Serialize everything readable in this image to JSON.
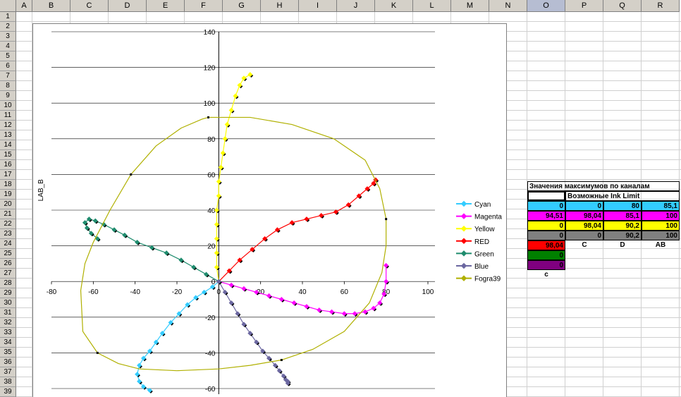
{
  "sheet": {
    "columns": [
      "A",
      "B",
      "C",
      "D",
      "E",
      "F",
      "G",
      "H",
      "I",
      "J",
      "K",
      "L",
      "M",
      "N",
      "O",
      "P",
      "Q",
      "R"
    ],
    "selected_column": "O",
    "rows": [
      "1",
      "2",
      "3",
      "4",
      "5",
      "6",
      "7",
      "8",
      "9",
      "10",
      "11",
      "12",
      "13",
      "14",
      "15",
      "16",
      "17",
      "18",
      "19",
      "20",
      "21",
      "22",
      "23",
      "24",
      "25",
      "26",
      "27",
      "28",
      "29",
      "30",
      "31",
      "32",
      "33",
      "34",
      "35",
      "36",
      "37",
      "38",
      "39"
    ]
  },
  "table": {
    "title": "Значения максимумов по каналам",
    "subtitle": "Возможные Ink Limit",
    "rows": [
      {
        "o": "0",
        "p": "0",
        "q": "80",
        "r": "85,1",
        "color": "#33ccff"
      },
      {
        "o": "94,51",
        "p": "98,04",
        "q": "85,1",
        "r": "100",
        "color": "#ff00ff"
      },
      {
        "o": "0",
        "p": "98,04",
        "q": "90,2",
        "r": "100",
        "color": "#ffff00"
      },
      {
        "o": "0",
        "p": "0",
        "q": "90,2",
        "r": "100",
        "color": "#808080"
      }
    ],
    "extra_o": [
      {
        "value": "98,04",
        "color": "#ff0000"
      },
      {
        "value": "0",
        "color": "#008000"
      },
      {
        "value": "0",
        "color": "#800080"
      }
    ],
    "labels": {
      "c_upper": "C",
      "d": "D",
      "ab": "AB",
      "c_lower": "c"
    }
  },
  "chart_data": {
    "type": "scatter",
    "ylabel": "LAB_B",
    "xlabel": "",
    "xlim": [
      -80,
      100
    ],
    "ylim": [
      -60,
      140
    ],
    "xticks": [
      "-80",
      "-60",
      "-40",
      "-20",
      "0",
      "20",
      "40",
      "60",
      "80",
      "100"
    ],
    "yticks": [
      "140",
      "120",
      "100",
      "80",
      "60",
      "40",
      "20",
      "0",
      "-20",
      "-40",
      "-60"
    ],
    "grid": true,
    "legend_position": "right",
    "series": [
      {
        "name": "Cyan",
        "color": "#33ccff",
        "x": [
          0,
          -3,
          -7,
          -11,
          -15,
          -19,
          -23,
          -27,
          -30,
          -33,
          -36,
          -38,
          -39,
          -38,
          -36,
          -33
        ],
        "y": [
          0,
          -3,
          -6,
          -9,
          -13,
          -18,
          -23,
          -29,
          -34,
          -39,
          -43,
          -47,
          -52,
          -56,
          -59,
          -61
        ]
      },
      {
        "name": "Magenta",
        "color": "#ff00ff",
        "x": [
          0,
          6,
          12,
          18,
          24,
          30,
          36,
          42,
          48,
          54,
          60,
          65,
          70,
          74,
          77,
          79,
          80,
          80
        ],
        "y": [
          0,
          -2,
          -4,
          -6,
          -8,
          -10,
          -12,
          -14,
          -16,
          -17,
          -18,
          -18,
          -17,
          -15,
          -12,
          -7,
          0,
          9
        ],
        "hull_x": [],
        "hull_y": []
      },
      {
        "name": "Yellow",
        "color": "#ffff00",
        "x": [
          0,
          -1,
          -1,
          -1,
          -1,
          -1,
          0,
          0,
          1,
          2,
          3,
          4,
          6,
          8,
          10,
          12,
          15
        ],
        "y": [
          0,
          8,
          16,
          24,
          32,
          40,
          48,
          56,
          64,
          72,
          80,
          88,
          96,
          104,
          110,
          114,
          116
        ]
      },
      {
        "name": "RED",
        "color": "#ff0000",
        "x": [
          0,
          5,
          10,
          16,
          22,
          28,
          35,
          42,
          49,
          56,
          62,
          67,
          71,
          74,
          75
        ],
        "y": [
          0,
          6,
          12,
          18,
          24,
          29,
          33,
          35,
          37,
          39,
          43,
          48,
          52,
          55,
          57
        ]
      },
      {
        "name": "Green",
        "color": "#1f8c6e",
        "x": [
          0,
          -6,
          -12,
          -18,
          -25,
          -32,
          -39,
          -45,
          -50,
          -55,
          -59,
          -62,
          -64,
          -63,
          -61,
          -58
        ],
        "y": [
          0,
          4,
          8,
          12,
          16,
          19,
          22,
          26,
          29,
          32,
          34,
          35,
          33,
          30,
          27,
          24
        ]
      },
      {
        "name": "Blue",
        "color": "#6b67a0",
        "x": [
          0,
          3,
          6,
          9,
          12,
          15,
          18,
          21,
          24,
          27,
          29,
          31,
          32,
          33,
          33
        ],
        "y": [
          0,
          -6,
          -12,
          -18,
          -24,
          -29,
          -34,
          -39,
          -43,
          -47,
          -50,
          -53,
          -55,
          -56,
          -57
        ]
      },
      {
        "name": "Fogra39",
        "color": "#b0b000",
        "x": [
          -5,
          15,
          35,
          55,
          70,
          77,
          80,
          80,
          78,
          72,
          60,
          45,
          30,
          15,
          0,
          -20,
          -38,
          -48,
          -58,
          -65,
          -66,
          -64,
          -60,
          -52,
          -42,
          -30,
          -18,
          -8,
          -5
        ],
        "y": [
          92,
          92,
          88,
          80,
          68,
          52,
          35,
          20,
          5,
          -12,
          -28,
          -38,
          -44,
          -47,
          -49,
          -50,
          -49,
          -46,
          -40,
          -28,
          -5,
          10,
          22,
          40,
          60,
          76,
          86,
          91,
          92
        ]
      }
    ]
  }
}
